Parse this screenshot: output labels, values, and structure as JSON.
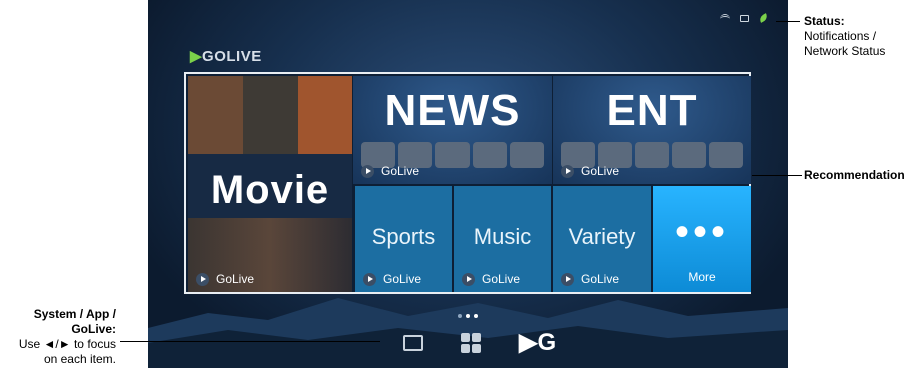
{
  "logo": "GOLIVE",
  "tiles": {
    "movie": "Movie",
    "news": "NEWS",
    "ent": "ENT",
    "sports": "Sports",
    "music": "Music",
    "variety": "Variety",
    "more": "More",
    "golive": "GoLive"
  },
  "annotations": {
    "status_title": "Status:",
    "status_line1": "Notifications /",
    "status_line2": "Network Status",
    "recommendation": "Recommendation",
    "sys_line1": "System / App /",
    "sys_line2": "GoLive:",
    "sys_line3": "Use ◄/► to focus",
    "sys_line4": "on each item."
  },
  "icons": [
    "wifi-icon",
    "tv-status-icon",
    "leaf-icon",
    "tv-icon",
    "apps-icon",
    "golive-icon",
    "play-icon"
  ],
  "colors": {
    "accent": "#28b4ff",
    "green": "#7bd14a",
    "tile": "#1c6ea2"
  }
}
